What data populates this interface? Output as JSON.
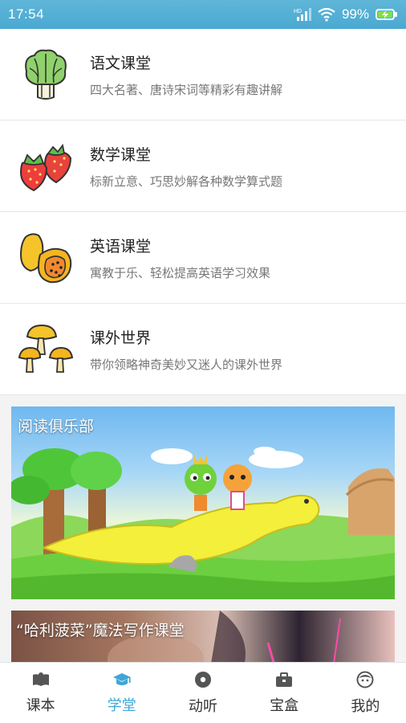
{
  "status_bar": {
    "time": "17:54",
    "network_label": "HD",
    "battery": "99%"
  },
  "courses": [
    {
      "title": "语文课堂",
      "subtitle": "四大名著、唐诗宋词等精彩有趣讲解",
      "icon": "cabbage-icon"
    },
    {
      "title": "数学课堂",
      "subtitle": "标新立意、巧思妙解各种数学算式题",
      "icon": "strawberry-icon"
    },
    {
      "title": "英语课堂",
      "subtitle": "寓教于乐、轻松提高英语学习效果",
      "icon": "papaya-icon"
    },
    {
      "title": "课外世界",
      "subtitle": "带你领略神奇美妙又迷人的课外世界",
      "icon": "mushroom-icon"
    }
  ],
  "banners": [
    {
      "title": "阅读俱乐部"
    },
    {
      "title": "“哈利菠菜”魔法写作课堂"
    }
  ],
  "tabs": [
    {
      "label": "课本",
      "icon": "book-icon",
      "active": false
    },
    {
      "label": "学堂",
      "icon": "graduation-cap-icon",
      "active": true
    },
    {
      "label": "动听",
      "icon": "disc-icon",
      "active": false
    },
    {
      "label": "宝盒",
      "icon": "toolbox-icon",
      "active": false
    },
    {
      "label": "我的",
      "icon": "face-icon",
      "active": false
    }
  ],
  "colors": {
    "status_bar": "#4aa9d1",
    "active_tab": "#3ea6d8",
    "inactive_tab": "#333333"
  }
}
